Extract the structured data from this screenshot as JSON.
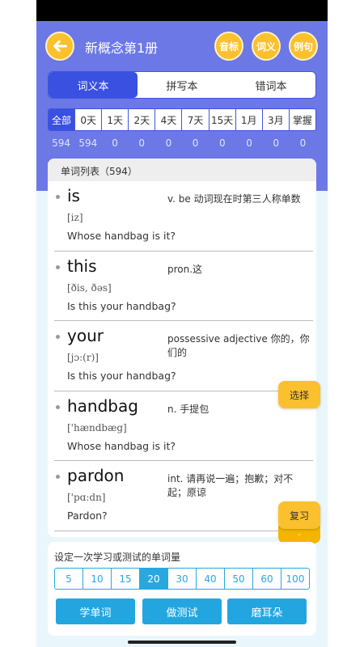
{
  "header": {
    "title": "新概念第1册",
    "buttons": [
      {
        "label": "音标"
      },
      {
        "label": "词义"
      },
      {
        "label": "例句"
      }
    ]
  },
  "segments": [
    {
      "label": "词义本",
      "active": true
    },
    {
      "label": "拼写本",
      "active": false
    },
    {
      "label": "错词本",
      "active": false
    }
  ],
  "filters": [
    {
      "label": "全部",
      "count": "594"
    },
    {
      "label": "0天",
      "count": "594"
    },
    {
      "label": "1天",
      "count": "0"
    },
    {
      "label": "2天",
      "count": "0"
    },
    {
      "label": "4天",
      "count": "0"
    },
    {
      "label": "7天",
      "count": "0"
    },
    {
      "label": "15天",
      "count": "0"
    },
    {
      "label": "1月",
      "count": "0"
    },
    {
      "label": "3月",
      "count": "0"
    },
    {
      "label": "掌握",
      "count": "0"
    }
  ],
  "list": {
    "header": "单词列表（594）",
    "words": [
      {
        "word": "is",
        "phonetic": "[iz]",
        "meaning": "v. be 动词现在时第三人称单数",
        "sentence": "Whose handbag is it?"
      },
      {
        "word": "this",
        "phonetic": "[ðis, ðəs]",
        "meaning": "pron.这",
        "sentence": "Is this your handbag?"
      },
      {
        "word": "your",
        "phonetic": "[jɔ:(r)]",
        "meaning": "possessive adjective 你的，你们的",
        "sentence": "Is this your handbag?"
      },
      {
        "word": "handbag",
        "phonetic": "['hændbæg]",
        "meaning": "n. 手提包",
        "sentence": "Whose handbag is it?"
      },
      {
        "word": "pardon",
        "phonetic": "['pɑ:dn]",
        "meaning": "int. 请再说一遍；抱歉；对不起；原谅",
        "sentence": "Pardon?"
      }
    ]
  },
  "floating": {
    "select_label": "选择",
    "review_label": "复习",
    "review_tail": "-"
  },
  "bottom": {
    "set_label": "设定一次学习或测试的单词量",
    "amounts": [
      "5",
      "10",
      "15",
      "20",
      "30",
      "40",
      "50",
      "60",
      "100"
    ],
    "selected_amount": "20",
    "actions": [
      "学单词",
      "做测试",
      "磨耳朵"
    ]
  },
  "colors": {
    "header_bg": "#6b78e6",
    "accent_blue": "#3a50e0",
    "button_yellow": "#fbc02d",
    "action_blue": "#23a6e0"
  },
  "icons": {
    "back": "arrow-left-icon"
  }
}
